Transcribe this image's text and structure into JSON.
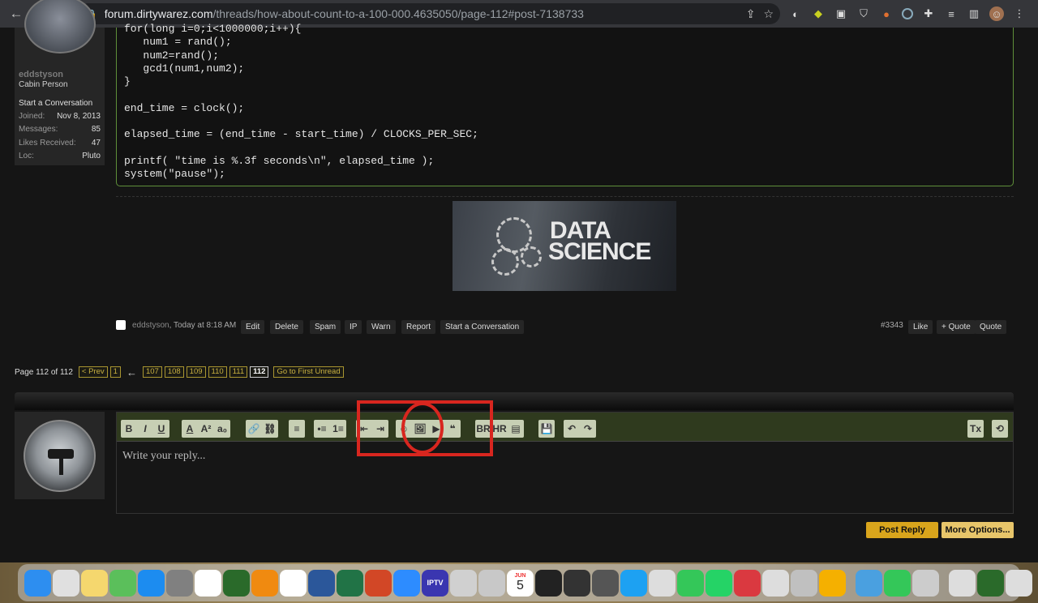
{
  "browser": {
    "url_host": "forum.dirtywarez.com",
    "url_path": "/threads/how-about-count-to-a-100-000.4635050/page-112#post-7138733"
  },
  "user": {
    "name": "eddstyson",
    "title": "Cabin Person",
    "start_conversation": "Start a Conversation",
    "stats": [
      {
        "label": "Joined:",
        "value": "Nov 8, 2013"
      },
      {
        "label": "Messages:",
        "value": "85"
      },
      {
        "label": "Likes Received:",
        "value": "47"
      },
      {
        "label": "Loc:",
        "value": "Pluto"
      }
    ]
  },
  "code": {
    "lines": [
      "for(long i=0;i<1000000;i++){",
      "   num1 = rand();",
      "   num2=rand();",
      "   gcd1(num1,num2);",
      "}",
      "",
      "end_time = clock();",
      "",
      "elapsed_time = (end_time - start_time) / CLOCKS_PER_SEC;",
      "",
      "printf( \"time is %.3f seconds\\n\", elapsed_time );",
      "system(\"pause\");"
    ]
  },
  "banner": {
    "line1": "DATA",
    "line2": "SCIENCE"
  },
  "post_footer": {
    "author": "eddstyson",
    "time": ", Today at 8:18 AM",
    "actions": [
      "Edit",
      "Delete",
      "Spam",
      "IP",
      "Warn",
      "Report",
      "Start a Conversation"
    ],
    "post_number": "#3343",
    "right_actions": [
      "Like",
      "+ Quote",
      "Quote"
    ]
  },
  "pager": {
    "label": "Page 112 of 112",
    "prev": "< Prev",
    "first": "1",
    "arrow": "←",
    "pages": [
      "107",
      "108",
      "109",
      "110",
      "111",
      "112"
    ],
    "current": "112",
    "first_unread": "Go to First Unread"
  },
  "editor": {
    "placeholder": "Write your reply...",
    "toolbar_groups": [
      [
        "B",
        "I",
        "U"
      ],
      [
        "A",
        "A²",
        "a₀"
      ],
      [
        "🔗",
        "⛓"
      ],
      [
        "≡"
      ],
      [
        "•≡",
        "1≡"
      ],
      [
        "⇤",
        "⇥"
      ],
      [
        "☺",
        "🖼",
        "▶",
        "❝"
      ],
      [
        "BR",
        "HR",
        "▤"
      ],
      [
        "💾"
      ],
      [
        "↶",
        "↷"
      ]
    ]
  },
  "buttons": {
    "post_reply": "Post Reply",
    "more_options": "More Options..."
  },
  "annotation_color": "#d8261f",
  "dock": {
    "icons": [
      "finder",
      "launchpad",
      "notes",
      "maps",
      "app-store",
      "system-preferences",
      "chrome",
      "globe",
      "vlc",
      "photos",
      "word",
      "excel",
      "powerpoint",
      "zoom",
      "iptv",
      "scripts",
      "preview",
      "calendar",
      "terminal",
      "imovie",
      "calculator",
      "twitter",
      "screenshot",
      "messages",
      "whatsapp",
      "express-vpn",
      "vpn",
      "pinball",
      "infuse",
      "archive",
      "facetime",
      "display",
      "downloads",
      "globe-2",
      "documents",
      "trash"
    ],
    "calendar_month": "JUN",
    "calendar_day": "5",
    "iptv_label": "IPTV"
  }
}
